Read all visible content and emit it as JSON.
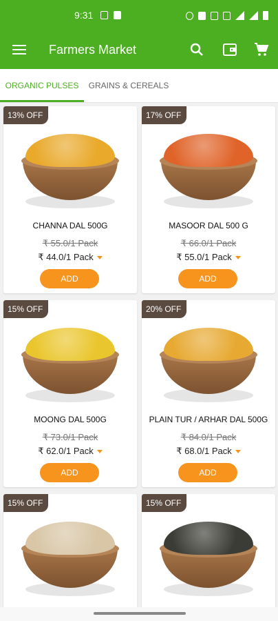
{
  "status_bar": {
    "time": "9:31",
    "icons": [
      "sim-icon",
      "image-icon",
      "alarm-icon",
      "nfc-icon",
      "data-icon",
      "mute-icon",
      "wifi-icon",
      "signal-icon",
      "battery-icon"
    ]
  },
  "app_bar": {
    "title": "Farmers Market",
    "color": "#4caf22",
    "actions": [
      "search-icon",
      "wallet-icon",
      "cart-icon"
    ]
  },
  "tabs": [
    {
      "label": "ORGANIC PULSES",
      "active": true
    },
    {
      "label": "GRAINS & CEREALS",
      "active": false
    }
  ],
  "products": [
    {
      "discount": "13% OFF",
      "name": "CHANNA DAL 500G",
      "original_price": "₹ 55.0/1 Pack",
      "price": "₹ 44.0/1 Pack",
      "add_label": "ADD",
      "grain_color": "#e9a92b"
    },
    {
      "discount": "17% OFF",
      "name": "MASOOR DAL 500 G",
      "original_price": "₹ 66.0/1 Pack",
      "price": "₹ 55.0/1 Pack",
      "add_label": "ADD",
      "grain_color": "#e0642a"
    },
    {
      "discount": "15% OFF",
      "name": "MOONG DAL 500G",
      "original_price": "₹ 73.0/1 Pack",
      "price": "₹ 62.0/1 Pack",
      "add_label": "ADD",
      "grain_color": "#eac62e"
    },
    {
      "discount": "20% OFF",
      "name": "PLAIN TUR / ARHAR DAL 500G",
      "original_price": "₹ 84.0/1 Pack",
      "price": "₹ 68.0/1 Pack",
      "add_label": "ADD",
      "grain_color": "#e7a932"
    },
    {
      "discount": "15% OFF",
      "grain_color": "#d8c6a6"
    },
    {
      "discount": "15% OFF",
      "grain_color": "#3c3c36"
    }
  ],
  "colors": {
    "accent_orange": "#f7941d",
    "badge_brown": "#5b4a40"
  }
}
